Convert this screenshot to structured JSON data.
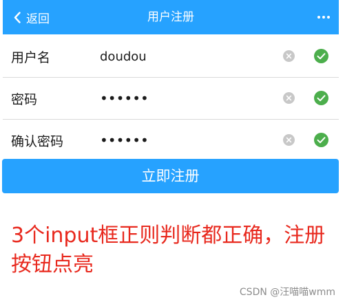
{
  "navbar": {
    "back_label": "返回",
    "title": "用户注册",
    "bg_color": "#26a2ff"
  },
  "form": {
    "fields": [
      {
        "label": "用户名",
        "value": "doudou",
        "type": "text"
      },
      {
        "label": "密码",
        "value": "123456",
        "type": "password"
      },
      {
        "label": "确认密码",
        "value": "123456",
        "type": "password"
      }
    ],
    "valid_color": "#4cae4c",
    "clear_color": "#c8c8c8"
  },
  "submit": {
    "label": "立即注册"
  },
  "annotation": {
    "text": "3个input框正则判断都正确，注册按钮点亮",
    "color": "#e8281d"
  },
  "watermark": {
    "text": "CSDN @汪喵喵wmm"
  }
}
